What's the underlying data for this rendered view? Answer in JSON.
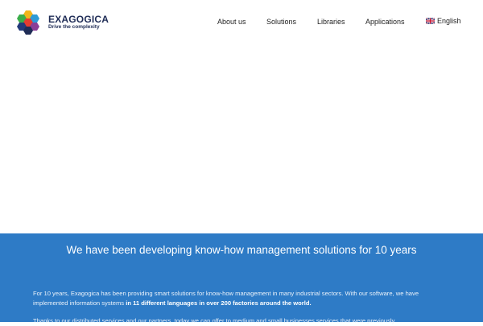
{
  "brand": {
    "name": "EXAGOGICA",
    "tagline": "Drive the complexity",
    "logo_icon": "hexagon-cluster-logo"
  },
  "nav": {
    "items": [
      "About us",
      "Solutions",
      "Libraries",
      "Applications"
    ],
    "language": "English",
    "language_flag": "uk-flag-icon"
  },
  "hero": {
    "headline": "We have been developing know-how management solutions for 10 years",
    "paragraph1_start": "For 10 years, Exagogica has been providing smart solutions for know-how management in many industrial sectors. With our software, we have implemented information systems ",
    "paragraph1_bold": "in 11 different languages in over 200 factories around the world.",
    "paragraph2": "Thanks to our distributed services and our partners, today we can offer to medium and small businesses services that were previously"
  },
  "colors": {
    "brand_dark": "#1f2c56",
    "section_blue": "#2e7bc6"
  }
}
